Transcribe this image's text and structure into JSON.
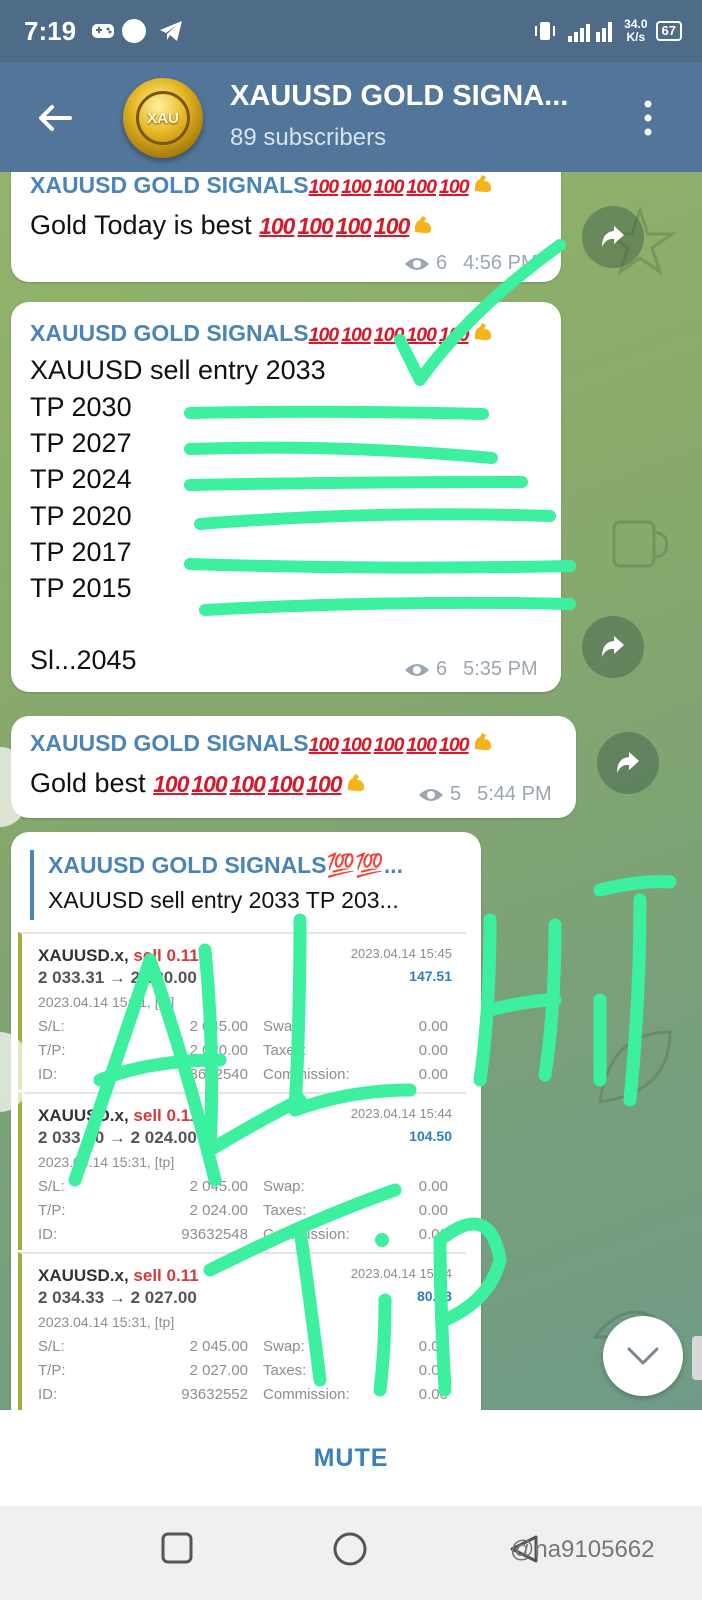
{
  "status_bar": {
    "time": "7:19",
    "net_speed": "34.0",
    "net_unit": "K/s",
    "battery": "67"
  },
  "header": {
    "avatar_text": "XAU",
    "title": "XAUUSD GOLD SIGNA...",
    "subtitle": "89 subscribers"
  },
  "messages": [
    {
      "sender": "XAUUSD GOLD SIGNALS",
      "text": "Gold Today is best",
      "views": "6",
      "time": "4:56 PM"
    },
    {
      "sender": "XAUUSD GOLD SIGNALS",
      "lines": [
        "XAUUSD sell entry 2033",
        "TP 2030",
        "TP 2027",
        "TP 2024",
        "TP 2020",
        "TP 2017",
        "TP 2015",
        "Sl...2045"
      ],
      "views": "6",
      "time": "5:35 PM"
    },
    {
      "sender": "XAUUSD GOLD SIGNALS",
      "text": "Gold best",
      "views": "5",
      "time": "5:44 PM"
    },
    {
      "reply_title": "XAUUSD GOLD SIGNALS💯💯...",
      "reply_text": "XAUUSD sell entry 2033 TP 203..."
    }
  ],
  "emoji": {
    "hundred": "100"
  },
  "trades": [
    {
      "symbol": "XAUUSD.x,",
      "side": "sell 0.11",
      "date": "2023.04.14 15:45",
      "price": "2 033.31 → 2 020.00",
      "profit": "147.51",
      "opened": "2023.04.14 15:31, [tp]",
      "sl": "2 045.00",
      "tp": "2 020.00",
      "id": "93632540",
      "swap": "0.00",
      "taxes": "0.00",
      "commission": "0.00"
    },
    {
      "symbol": "XAUUSD.x,",
      "side": "sell 0.11",
      "date": "2023.04.14 15:44",
      "price": "2 033.50 → 2 024.00",
      "profit": "104.50",
      "opened": "2023.04.14 15:31, [tp]",
      "sl": "2 045.00",
      "tp": "2 024.00",
      "id": "93632548",
      "swap": "0.00",
      "taxes": "0.00",
      "commission": "0.00"
    },
    {
      "symbol": "XAUUSD.x,",
      "side": "sell 0.11",
      "date": "2023.04.14 15:44",
      "price": "2 034.33 → 2 027.00",
      "profit": "80.63",
      "opened": "2023.04.14 15:31, [tp]",
      "sl": "2 045.00",
      "tp": "2 027.00",
      "id": "93632552",
      "swap": "0.00",
      "taxes": "0.00",
      "commission": "0.00"
    }
  ],
  "trade_labels": {
    "sl": "S/L:",
    "tp": "T/P:",
    "id": "ID:",
    "swap": "Swap:",
    "taxes": "Taxes:",
    "commission": "Commission:"
  },
  "annotation": {
    "text": "ALL HIT TIP",
    "color": "#3df0a0"
  },
  "bottom": {
    "mute": "MUTE",
    "watermark": "@na9105662"
  }
}
